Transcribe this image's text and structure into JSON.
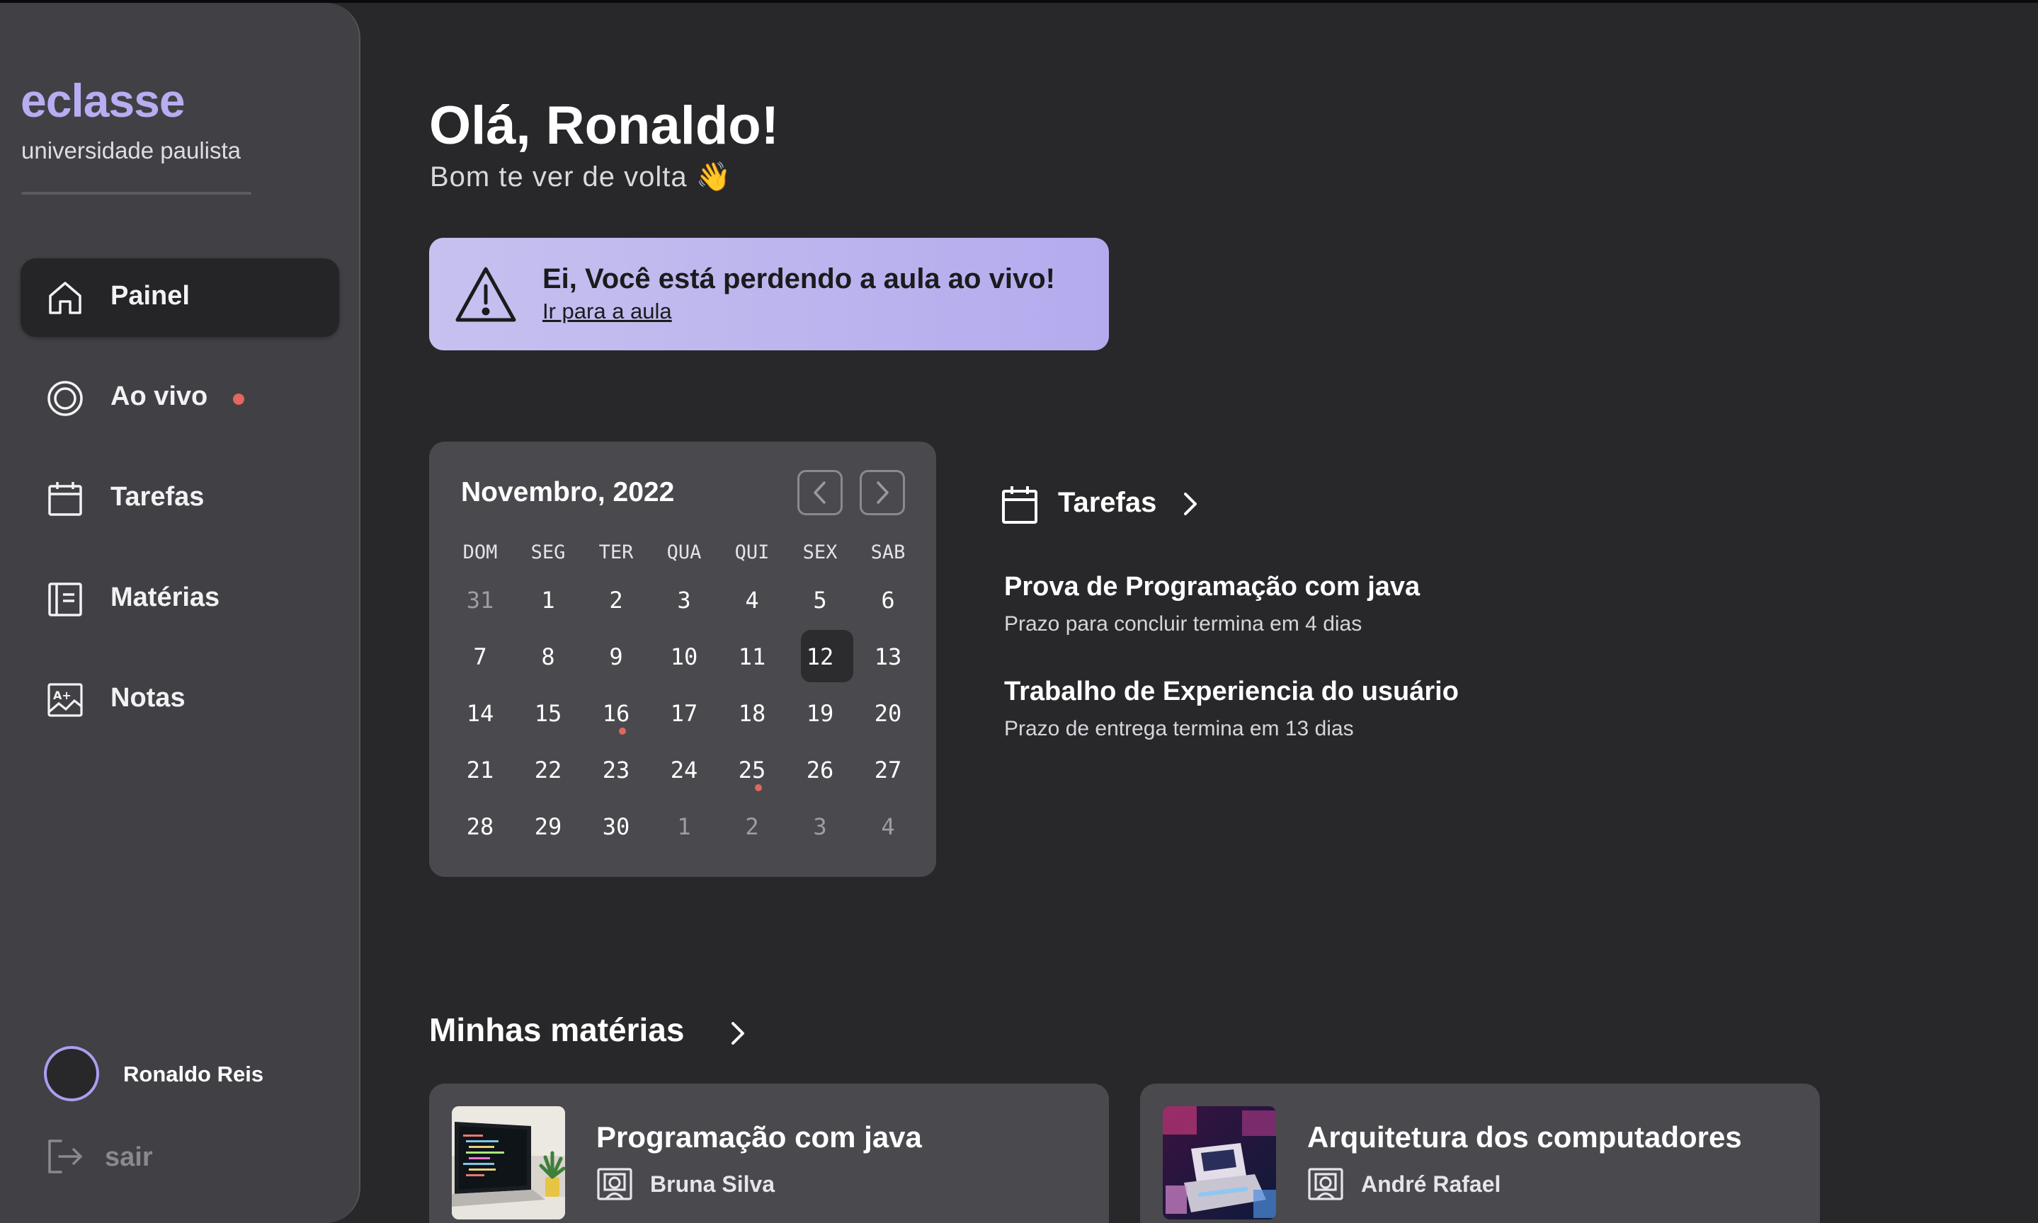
{
  "brand": {
    "name": "eclasse",
    "subtitle": "universidade paulista"
  },
  "nav": {
    "items": [
      {
        "label": "Painel",
        "icon": "home-icon",
        "active": true
      },
      {
        "label": "Ao vivo",
        "icon": "live-icon",
        "badge": "live-dot"
      },
      {
        "label": "Tarefas",
        "icon": "calendar-icon"
      },
      {
        "label": "Matérias",
        "icon": "book-icon"
      },
      {
        "label": "Notas",
        "icon": "grade-icon"
      }
    ]
  },
  "user": {
    "name": "Ronaldo Reis",
    "logout_label": "sair"
  },
  "header": {
    "greeting": "Olá, Ronaldo!",
    "subtitle": "Bom te ver de volta 👋"
  },
  "alert": {
    "title": "Ei, Você está perdendo a aula ao vivo!",
    "link": "Ir para a aula"
  },
  "calendar": {
    "title": "Novembro, 2022",
    "weekdays": [
      "DOM",
      "SEG",
      "TER",
      "QUA",
      "QUI",
      "SEX",
      "SAB"
    ],
    "weeks": [
      [
        "31",
        "1",
        "2",
        "3",
        "4",
        "5",
        "6"
      ],
      [
        "7",
        "8",
        "9",
        "10",
        "11",
        "12",
        "13"
      ],
      [
        "14",
        "15",
        "16",
        "17",
        "18",
        "19",
        "20"
      ],
      [
        "21",
        "22",
        "23",
        "24",
        "25",
        "26",
        "27"
      ],
      [
        "28",
        "29",
        "30",
        "1",
        "2",
        "3",
        "4"
      ]
    ],
    "today": "12",
    "event_days": [
      "16",
      "25"
    ]
  },
  "tasks": {
    "title": "Tarefas",
    "items": [
      {
        "title": "Prova de Programação com java",
        "subtitle": "Prazo para concluir termina em 4 dias"
      },
      {
        "title": "Trabalho de Experiencia do usuário",
        "subtitle": "Prazo de entrega termina em 13 dias"
      }
    ]
  },
  "subjects": {
    "title": "Minhas matérias",
    "items": [
      {
        "name": "Programação com java",
        "teacher": "Bruna Silva",
        "thumbnail": "laptop-code-photo"
      },
      {
        "name": "Arquitetura dos computadores",
        "teacher": "André Rafael",
        "thumbnail": "retro-computer-photo"
      }
    ]
  },
  "colors": {
    "accent": "#b6adf2",
    "background": "#28282b",
    "sidebar": "#414045",
    "card": "#4a494e",
    "live_dot": "#e2675c"
  }
}
